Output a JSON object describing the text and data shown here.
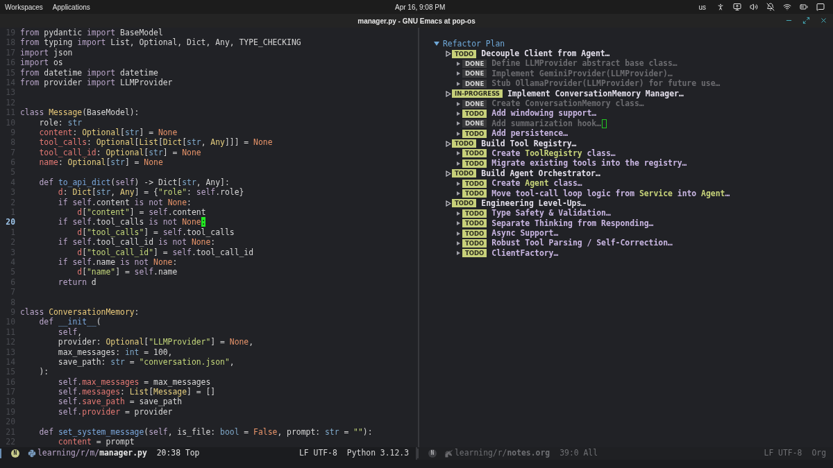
{
  "top_bar": {
    "menus": [
      "Workspaces",
      "Applications"
    ],
    "clock": "Apr 16, 9:08 PM",
    "keyboard_layout": "us"
  },
  "window": {
    "title": "manager.py - GNU Emacs at pop-os"
  },
  "code": {
    "lines": [
      {
        "number": "19",
        "current": false,
        "tokens": [
          {
            "kind": "kw",
            "text": "from"
          },
          {
            "kind": "plain",
            "text": " pydantic "
          },
          {
            "kind": "kw",
            "text": "import"
          },
          {
            "kind": "plain",
            "text": " BaseModel"
          }
        ]
      },
      {
        "number": "18",
        "current": false,
        "tokens": [
          {
            "kind": "kw",
            "text": "from"
          },
          {
            "kind": "plain",
            "text": " typing "
          },
          {
            "kind": "kw",
            "text": "import"
          },
          {
            "kind": "plain",
            "text": " List, Optional, Dict, Any, TYPE_CHECKING"
          }
        ]
      },
      {
        "number": "17",
        "current": false,
        "tokens": [
          {
            "kind": "kw",
            "text": "import"
          },
          {
            "kind": "plain",
            "text": " json"
          }
        ]
      },
      {
        "number": "16",
        "current": false,
        "tokens": [
          {
            "kind": "kw",
            "text": "import"
          },
          {
            "kind": "plain",
            "text": " os"
          }
        ]
      },
      {
        "number": "15",
        "current": false,
        "tokens": [
          {
            "kind": "kw",
            "text": "from"
          },
          {
            "kind": "plain",
            "text": " datetime "
          },
          {
            "kind": "kw",
            "text": "import"
          },
          {
            "kind": "plain",
            "text": " datetime"
          }
        ]
      },
      {
        "number": "14",
        "current": false,
        "tokens": [
          {
            "kind": "kw",
            "text": "from"
          },
          {
            "kind": "plain",
            "text": " provider "
          },
          {
            "kind": "kw",
            "text": "import"
          },
          {
            "kind": "plain",
            "text": " LLMProvider"
          }
        ]
      },
      {
        "number": "13",
        "current": false
      },
      {
        "number": "12",
        "current": false
      },
      {
        "number": "11",
        "current": false,
        "tokens": [
          {
            "kind": "kw",
            "text": "class "
          },
          {
            "kind": "cls",
            "text": "Message"
          },
          {
            "kind": "plain",
            "text": "(BaseModel):"
          }
        ]
      },
      {
        "number": "10",
        "current": false,
        "tokens": [
          {
            "kind": "plain",
            "text": "    role: "
          },
          {
            "kind": "builtin",
            "text": "str"
          }
        ]
      },
      {
        "number": "9",
        "current": false,
        "tokens": [
          {
            "kind": "field",
            "text": "    content"
          },
          {
            "kind": "plain",
            "text": ": "
          },
          {
            "kind": "type",
            "text": "Optional"
          },
          {
            "kind": "plain",
            "text": "["
          },
          {
            "kind": "builtin",
            "text": "str"
          },
          {
            "kind": "plain",
            "text": "] = "
          },
          {
            "kind": "const",
            "text": "None"
          }
        ]
      },
      {
        "number": "8",
        "current": false,
        "tokens": [
          {
            "kind": "field",
            "text": "    tool_calls"
          },
          {
            "kind": "plain",
            "text": ": "
          },
          {
            "kind": "type",
            "text": "Optional"
          },
          {
            "kind": "plain",
            "text": "["
          },
          {
            "kind": "type",
            "text": "List"
          },
          {
            "kind": "plain",
            "text": "["
          },
          {
            "kind": "type",
            "text": "Dict"
          },
          {
            "kind": "plain",
            "text": "["
          },
          {
            "kind": "builtin",
            "text": "str"
          },
          {
            "kind": "plain",
            "text": ", "
          },
          {
            "kind": "type",
            "text": "Any"
          },
          {
            "kind": "plain",
            "text": "]]] = "
          },
          {
            "kind": "const",
            "text": "None"
          }
        ]
      },
      {
        "number": "7",
        "current": false,
        "tokens": [
          {
            "kind": "field",
            "text": "    tool_call_id"
          },
          {
            "kind": "plain",
            "text": ": "
          },
          {
            "kind": "type",
            "text": "Optional"
          },
          {
            "kind": "plain",
            "text": "["
          },
          {
            "kind": "builtin",
            "text": "str"
          },
          {
            "kind": "plain",
            "text": "] = "
          },
          {
            "kind": "const",
            "text": "None"
          }
        ]
      },
      {
        "number": "6",
        "current": false,
        "tokens": [
          {
            "kind": "field",
            "text": "    name"
          },
          {
            "kind": "plain",
            "text": ": "
          },
          {
            "kind": "type",
            "text": "Optional"
          },
          {
            "kind": "plain",
            "text": "["
          },
          {
            "kind": "builtin",
            "text": "str"
          },
          {
            "kind": "plain",
            "text": "] = "
          },
          {
            "kind": "const",
            "text": "None"
          }
        ]
      },
      {
        "number": "5",
        "current": false
      },
      {
        "number": "4",
        "current": false,
        "tokens": [
          {
            "kind": "kw",
            "text": "    def "
          },
          {
            "kind": "func",
            "text": "to_api_dict"
          },
          {
            "kind": "plain",
            "text": "("
          },
          {
            "kind": "kw",
            "text": "self"
          },
          {
            "kind": "plain",
            "text": ") -> Dict["
          },
          {
            "kind": "builtin",
            "text": "str"
          },
          {
            "kind": "plain",
            "text": ", Any]:"
          }
        ]
      },
      {
        "number": "3",
        "current": false,
        "tokens": [
          {
            "kind": "field",
            "text": "        d"
          },
          {
            "kind": "plain",
            "text": ": "
          },
          {
            "kind": "type",
            "text": "Dict"
          },
          {
            "kind": "plain",
            "text": "["
          },
          {
            "kind": "builtin",
            "text": "str"
          },
          {
            "kind": "plain",
            "text": ", "
          },
          {
            "kind": "type",
            "text": "Any"
          },
          {
            "kind": "plain",
            "text": "] = {"
          },
          {
            "kind": "string",
            "text": "\"role\""
          },
          {
            "kind": "plain",
            "text": ": "
          },
          {
            "kind": "kw",
            "text": "self"
          },
          {
            "kind": "plain",
            "text": ".role}"
          }
        ]
      },
      {
        "number": "2",
        "current": false,
        "tokens": [
          {
            "kind": "kw",
            "text": "        if self"
          },
          {
            "kind": "plain",
            "text": ".content "
          },
          {
            "kind": "kw",
            "text": "is not "
          },
          {
            "kind": "const",
            "text": "None"
          },
          {
            "kind": "plain",
            "text": ":"
          }
        ]
      },
      {
        "number": "1",
        "current": false,
        "tokens": [
          {
            "kind": "field",
            "text": "            d"
          },
          {
            "kind": "plain",
            "text": "["
          },
          {
            "kind": "string",
            "text": "\"content\""
          },
          {
            "kind": "plain",
            "text": "] = "
          },
          {
            "kind": "kw",
            "text": "self"
          },
          {
            "kind": "plain",
            "text": ".content"
          }
        ]
      },
      {
        "number": "20",
        "current": true,
        "tokens": [
          {
            "kind": "kw",
            "text": "        if self"
          },
          {
            "kind": "plain",
            "text": ".tool_calls "
          },
          {
            "kind": "kw",
            "text": "is not "
          },
          {
            "kind": "const",
            "text": "None"
          },
          {
            "kind": "cursor",
            "text": ":"
          }
        ]
      },
      {
        "number": "1",
        "current": false,
        "tokens": [
          {
            "kind": "field",
            "text": "            d"
          },
          {
            "kind": "plain",
            "text": "["
          },
          {
            "kind": "string",
            "text": "\"tool_calls\""
          },
          {
            "kind": "plain",
            "text": "] = "
          },
          {
            "kind": "kw",
            "text": "self"
          },
          {
            "kind": "plain",
            "text": ".tool_calls"
          }
        ]
      },
      {
        "number": "2",
        "current": false,
        "tokens": [
          {
            "kind": "kw",
            "text": "        if self"
          },
          {
            "kind": "plain",
            "text": ".tool_call_id "
          },
          {
            "kind": "kw",
            "text": "is not "
          },
          {
            "kind": "const",
            "text": "None"
          },
          {
            "kind": "plain",
            "text": ":"
          }
        ]
      },
      {
        "number": "3",
        "current": false,
        "tokens": [
          {
            "kind": "field",
            "text": "            d"
          },
          {
            "kind": "plain",
            "text": "["
          },
          {
            "kind": "string",
            "text": "\"tool_call_id\""
          },
          {
            "kind": "plain",
            "text": "] = "
          },
          {
            "kind": "kw",
            "text": "self"
          },
          {
            "kind": "plain",
            "text": ".tool_call_id"
          }
        ]
      },
      {
        "number": "4",
        "current": false,
        "tokens": [
          {
            "kind": "kw",
            "text": "        if self"
          },
          {
            "kind": "plain",
            "text": ".name "
          },
          {
            "kind": "kw",
            "text": "is not "
          },
          {
            "kind": "const",
            "text": "None"
          },
          {
            "kind": "plain",
            "text": ":"
          }
        ]
      },
      {
        "number": "5",
        "current": false,
        "tokens": [
          {
            "kind": "field",
            "text": "            d"
          },
          {
            "kind": "plain",
            "text": "["
          },
          {
            "kind": "string",
            "text": "\"name\""
          },
          {
            "kind": "plain",
            "text": "] = "
          },
          {
            "kind": "kw",
            "text": "self"
          },
          {
            "kind": "plain",
            "text": ".name"
          }
        ]
      },
      {
        "number": "6",
        "current": false,
        "tokens": [
          {
            "kind": "kw",
            "text": "        return"
          },
          {
            "kind": "plain",
            "text": " d"
          }
        ]
      },
      {
        "number": "7",
        "current": false
      },
      {
        "number": "8",
        "current": false
      },
      {
        "number": "9",
        "current": false,
        "tokens": [
          {
            "kind": "kw",
            "text": "class "
          },
          {
            "kind": "cls",
            "text": "ConversationMemory"
          },
          {
            "kind": "plain",
            "text": ":"
          }
        ]
      },
      {
        "number": "10",
        "current": false,
        "tokens": [
          {
            "kind": "kw",
            "text": "    def "
          },
          {
            "kind": "func",
            "text": "__init__"
          },
          {
            "kind": "plain",
            "text": "("
          }
        ]
      },
      {
        "number": "11",
        "current": false,
        "tokens": [
          {
            "kind": "kw",
            "text": "        self"
          },
          {
            "kind": "plain",
            "text": ","
          }
        ]
      },
      {
        "number": "12",
        "current": false,
        "tokens": [
          {
            "kind": "plain",
            "text": "        provider: "
          },
          {
            "kind": "type",
            "text": "Optional"
          },
          {
            "kind": "plain",
            "text": "["
          },
          {
            "kind": "string",
            "text": "\"LLMProvider\""
          },
          {
            "kind": "plain",
            "text": "] = "
          },
          {
            "kind": "const",
            "text": "None"
          },
          {
            "kind": "plain",
            "text": ","
          }
        ]
      },
      {
        "number": "13",
        "current": false,
        "tokens": [
          {
            "kind": "plain",
            "text": "        max_messages: "
          },
          {
            "kind": "builtin",
            "text": "int"
          },
          {
            "kind": "plain",
            "text": " = 100,"
          }
        ]
      },
      {
        "number": "14",
        "current": false,
        "tokens": [
          {
            "kind": "plain",
            "text": "        save_path: "
          },
          {
            "kind": "builtin",
            "text": "str"
          },
          {
            "kind": "plain",
            "text": " = "
          },
          {
            "kind": "string",
            "text": "\"conversation.json\""
          },
          {
            "kind": "plain",
            "text": ","
          }
        ]
      },
      {
        "number": "15",
        "current": false,
        "tokens": [
          {
            "kind": "plain",
            "text": "    ):"
          }
        ]
      },
      {
        "number": "16",
        "current": false,
        "tokens": [
          {
            "kind": "kw",
            "text": "        self."
          },
          {
            "kind": "field",
            "text": "max_messages"
          },
          {
            "kind": "plain",
            "text": " = max_messages"
          }
        ]
      },
      {
        "number": "17",
        "current": false,
        "tokens": [
          {
            "kind": "kw",
            "text": "        self."
          },
          {
            "kind": "field",
            "text": "messages"
          },
          {
            "kind": "plain",
            "text": ": "
          },
          {
            "kind": "type",
            "text": "List"
          },
          {
            "kind": "plain",
            "text": "["
          },
          {
            "kind": "type",
            "text": "Message"
          },
          {
            "kind": "plain",
            "text": "] = []"
          }
        ]
      },
      {
        "number": "18",
        "current": false,
        "tokens": [
          {
            "kind": "kw",
            "text": "        self."
          },
          {
            "kind": "field",
            "text": "save_path"
          },
          {
            "kind": "plain",
            "text": " = save_path"
          }
        ]
      },
      {
        "number": "19",
        "current": false,
        "tokens": [
          {
            "kind": "kw",
            "text": "        self."
          },
          {
            "kind": "field",
            "text": "provider"
          },
          {
            "kind": "plain",
            "text": " = provider"
          }
        ]
      },
      {
        "number": "20",
        "current": false
      },
      {
        "number": "21",
        "current": false,
        "tokens": [
          {
            "kind": "kw",
            "text": "    def "
          },
          {
            "kind": "func",
            "text": "set_system_message"
          },
          {
            "kind": "plain",
            "text": "("
          },
          {
            "kind": "kw",
            "text": "self"
          },
          {
            "kind": "plain",
            "text": ", is_file: "
          },
          {
            "kind": "builtin",
            "text": "bool"
          },
          {
            "kind": "plain",
            "text": " = "
          },
          {
            "kind": "const",
            "text": "False"
          },
          {
            "kind": "plain",
            "text": ", prompt: "
          },
          {
            "kind": "builtin",
            "text": "str"
          },
          {
            "kind": "plain",
            "text": " = "
          },
          {
            "kind": "string",
            "text": "\"\""
          },
          {
            "kind": "plain",
            "text": "):"
          }
        ]
      },
      {
        "number": "22",
        "current": false,
        "tokens": [
          {
            "kind": "field",
            "text": "        content"
          },
          {
            "kind": "plain",
            "text": " = prompt"
          }
        ]
      }
    ]
  },
  "outline": {
    "title": "Refactor Plan",
    "expanded": true,
    "children": [
      {
        "keyword": "TODO",
        "done": false,
        "title": "Decouple Client from Agent…",
        "children": [
          {
            "keyword": "DONE",
            "done": true,
            "title": "Define LLMProvider abstract base class…"
          },
          {
            "keyword": "DONE",
            "done": true,
            "title": "Implement GeminiProvider(LLMProvider)…"
          },
          {
            "keyword": "DONE",
            "done": true,
            "title": "Stub OllamaProvider(LLMProvider) for future use…"
          }
        ]
      },
      {
        "keyword": "IN-PROGRESS",
        "done": false,
        "title": "Implement ConversationMemory Manager…",
        "children": [
          {
            "keyword": "DONE",
            "done": true,
            "title": "Create ConversationMemory class…"
          },
          {
            "keyword": "TODO",
            "done": false,
            "title": "Add windowing support…"
          },
          {
            "keyword": "DONE",
            "done": true,
            "title": "Add summarization hook…",
            "cursor": true
          },
          {
            "keyword": "TODO",
            "done": false,
            "title": "Add persistence…"
          }
        ]
      },
      {
        "keyword": "TODO",
        "done": false,
        "title": "Build Tool Registry…",
        "children": [
          {
            "keyword": "TODO",
            "done": false,
            "title": "Create *ToolRegistry* class…"
          },
          {
            "keyword": "TODO",
            "done": false,
            "title": "Migrate existing tools into the registry…"
          }
        ]
      },
      {
        "keyword": "TODO",
        "done": false,
        "title": "Build Agent Orchestrator…",
        "children": [
          {
            "keyword": "TODO",
            "done": false,
            "title": "Create *Agent* class…"
          },
          {
            "keyword": "TODO",
            "done": false,
            "title": "Move tool-call loop logic from *Service* into *Agent*…"
          }
        ]
      },
      {
        "keyword": "TODO",
        "done": false,
        "title": "Engineering Level-Ups…",
        "children": [
          {
            "keyword": "TODO",
            "done": false,
            "title": "Type Safety & Validation…"
          },
          {
            "keyword": "TODO",
            "done": false,
            "title": "Separate Thinking from Responding…"
          },
          {
            "keyword": "TODO",
            "done": false,
            "title": "Async Support…"
          },
          {
            "keyword": "TODO",
            "done": false,
            "title": "Robust Tool Parsing / Self-Correction…"
          },
          {
            "keyword": "TODO",
            "done": false,
            "title": "ClientFactory…"
          }
        ]
      }
    ]
  },
  "mode_lines": [
    {
      "active": true,
      "kind": "python",
      "state": "N",
      "directory": "learning/r/m/",
      "file": "manager.py",
      "position": "20:38 Top",
      "encoding": "LF UTF-8",
      "mode": "Python 3.12.3"
    },
    {
      "active": false,
      "kind": "org",
      "state": "N",
      "directory": "learning/r/",
      "file": "notes.org",
      "position": "39:0 All",
      "encoding": "LF UTF-8",
      "mode": "Org"
    }
  ]
}
